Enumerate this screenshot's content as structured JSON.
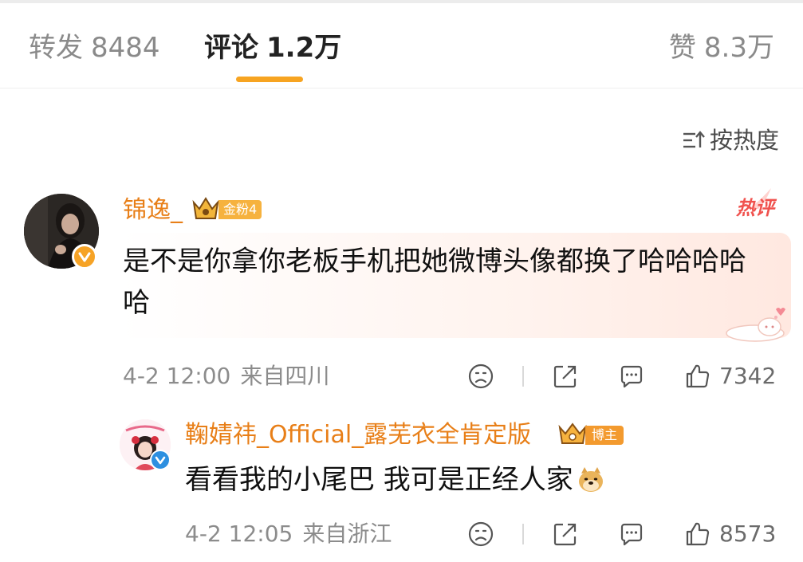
{
  "tabs": {
    "repost_label": "转发",
    "repost_count": "8484",
    "comment_label": "评论",
    "comment_count": "1.2万",
    "like_label": "赞",
    "like_count": "8.3万",
    "active": "comment",
    "accent_color": "#f7a421"
  },
  "sort": {
    "label": "按热度",
    "icon": "sort-icon"
  },
  "comments": [
    {
      "username": "锦逸_",
      "fan_badge": "金粉4",
      "verified_icon": "verified-orange-icon",
      "hot_tag": "热评",
      "text": "是不是你拿你老板手机把她微博头像都换了哈哈哈哈哈",
      "time": "4-2 12:00",
      "location": "来自四川",
      "likes": "7342"
    }
  ],
  "reply": {
    "username": "鞠婧祎_Official_露芜衣全肯定版",
    "host_badge": "博主",
    "verified_icon": "verified-blue-icon",
    "text": "看看我的小尾巴 我可是正经人家",
    "emoji": "doge-icon",
    "time": "4-2 12:05",
    "location": "来自浙江",
    "likes": "8573"
  },
  "colors": {
    "username": "#e87f18",
    "hot": "#f0524e",
    "meta": "#8c8c8c"
  }
}
